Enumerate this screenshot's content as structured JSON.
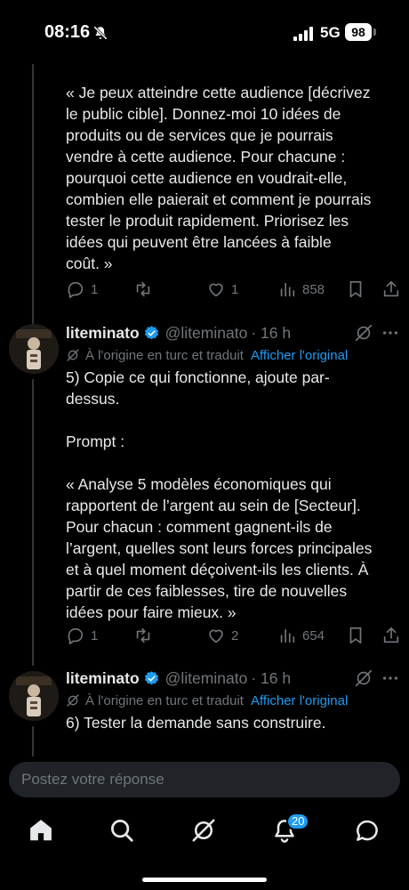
{
  "status_bar": {
    "time": "08:16",
    "network": "5G",
    "battery": "98"
  },
  "tweets": [
    {
      "text": "« Je peux atteindre cette audience [décrivez\nle public cible]. Donnez-moi 10 idées de\nproduits ou de services que je pourrais\nvendre à cette audience. Pour chacune :\npourquoi cette audience en voudrait-elle,\ncombien elle paierait et comment je pourrais\ntester le produit rapidement. Priorisez les\nidées qui peuvent être lancées à faible\ncoût. »",
      "replies": "1",
      "retweets": "",
      "likes": "1",
      "views": "858"
    },
    {
      "author": "liteminato",
      "handle": "@liteminato",
      "time": "· 16 h",
      "translated_from": "À l'origine en turc et traduit",
      "show_original": "Afficher l'original",
      "text": "5) Copie ce qui fonctionne, ajoute par-\ndessus.\n\nPrompt :\n\n« Analyse 5 modèles économiques qui\nrapportent de l’argent au sein de [Secteur].\nPour chacun : comment gagnent-ils de\nl’argent, quelles sont leurs forces principales\net à quel moment déçoivent-ils les clients. À\npartir de ces faiblesses, tire de nouvelles\nidées pour faire mieux. »",
      "replies": "1",
      "retweets": "",
      "likes": "2",
      "views": "654"
    },
    {
      "author": "liteminato",
      "handle": "@liteminato",
      "time": "· 16 h",
      "translated_from": "À l'origine en turc et traduit",
      "show_original": "Afficher l'original",
      "text": "6) Tester la demande sans construire."
    }
  ],
  "reply_box": {
    "placeholder": "Postez votre réponse"
  },
  "tab_bar": {
    "items": [
      "home-icon",
      "search-icon",
      "grok-icon",
      "notifications-icon",
      "messages-icon"
    ],
    "notifications_badge": "20"
  },
  "colors": {
    "background": "#000000",
    "text": "#e7e9ea",
    "muted": "#71767b",
    "accent": "#1d9bf0"
  }
}
